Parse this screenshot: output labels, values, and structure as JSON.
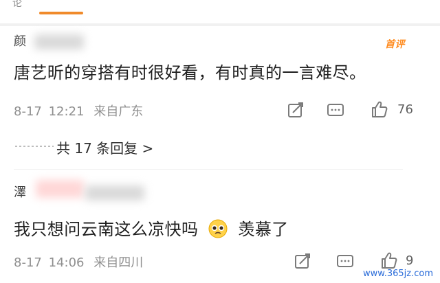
{
  "header": {
    "top_fragment": "论"
  },
  "comments": [
    {
      "user_initial": "颜",
      "hot_badge": "首评",
      "text": "唐艺昕的穿搭有时很好看，有时真的一言难尽。",
      "date": "8-17",
      "time": "12:21",
      "location": "来自广东",
      "like_count": "76",
      "replies_label": "共 17 条回复 >"
    },
    {
      "user_initial": "澤",
      "text": "我只想问云南这么凉快吗",
      "text_suffix": "羡慕了",
      "date": "8-17",
      "time": "14:06",
      "location": "来自四川",
      "like_count": "9"
    }
  ],
  "watermark": "www.365jz.com",
  "icons": {
    "share": "share-icon",
    "comment": "comment-icon",
    "like": "thumbs-up-icon",
    "emoji": "pleading-face-emoji-icon"
  },
  "colors": {
    "accent": "#f08a2b",
    "watermark": "#2a6cd9"
  }
}
